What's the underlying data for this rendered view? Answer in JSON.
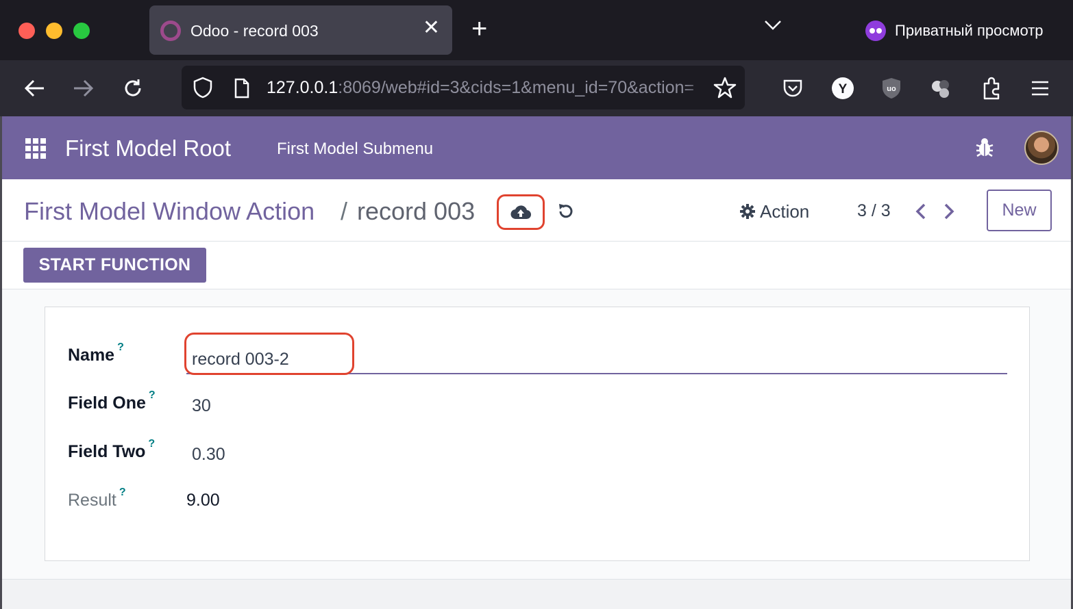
{
  "browser": {
    "tab": {
      "title": "Odoo - record 003",
      "close_glyph": "✕"
    },
    "new_tab_glyph": "+",
    "private_label": "Приватный просмотр",
    "url": {
      "host": "127.0.0.1",
      "rest": ":8069/web#id=3&cids=1&menu_id=70&action="
    }
  },
  "odoo": {
    "brand": "First Model Root",
    "submenu": "First Model Submenu",
    "breadcrumb": {
      "parent": "First Model Window Action",
      "separator": "/",
      "current": "record 003"
    },
    "action_label": "Action",
    "pager": "3 / 3",
    "new_label": "New",
    "start_function_label": "START FUNCTION",
    "form": {
      "name": {
        "label": "Name",
        "help": "?",
        "value": "record 003-2"
      },
      "field_one": {
        "label": "Field One",
        "help": "?",
        "value": "30"
      },
      "field_two": {
        "label": "Field Two",
        "help": "?",
        "value": "0.30"
      },
      "result": {
        "label": "Result",
        "help": "?",
        "value": "9.00"
      }
    }
  },
  "colors": {
    "odoo_primary": "#71639e",
    "highlight": "#e0432f",
    "browser_bg": "#1c1b22"
  }
}
